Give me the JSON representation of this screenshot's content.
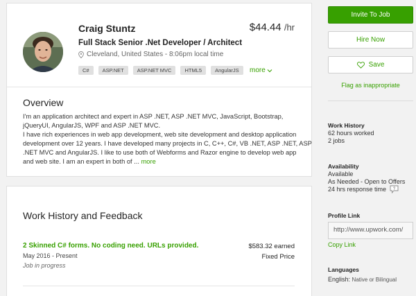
{
  "profile": {
    "name": "Craig Stuntz",
    "rate": "$44.44",
    "rate_unit": "/hr",
    "title": "Full Stack Senior .Net Developer / Architect",
    "location": "Cleveland, United States - 8:06pm local time",
    "skills": [
      "C#",
      "ASP.NET",
      "ASP.NET MVC",
      "HTML5",
      "AngularJS"
    ],
    "more_label": "more"
  },
  "overview": {
    "heading": "Overview",
    "lines": [
      "I'm an application architect and expert in ASP .NET, ASP .NET MVC, JavaScript, Bootstrap,",
      "jQueryUI, AngularJS, WPF and ASP .NET MVC.",
      "I have rich experiences in web app development, web site development and desktop application",
      "development over 12 years. I have developed many projects in C, C++, C#, VB .NET, ASP .NET, ASP",
      ".NET MVC and AngularJS. I like to use both of Webforms and Razor engine to develop web app",
      "and web site. I am an expert in both of ..."
    ],
    "more_label": "more"
  },
  "work_history": {
    "heading": "Work History and Feedback",
    "jobs": [
      {
        "title": "2 Skinned C# forms. No coding need. URLs provided.",
        "dates": "May 2016 - Present",
        "status": "Job in progress",
        "earned": "$583.32 earned",
        "type": "Fixed Price"
      }
    ]
  },
  "sidebar": {
    "invite_label": "Invite To Job",
    "hire_label": "Hire Now",
    "save_label": "Save",
    "flag_label": "Flag as inappropriate",
    "work_history_label": "Work History",
    "hours_worked": "62 hours worked",
    "jobs_count": "2 jobs",
    "availability_label": "Availability",
    "availability_status": "Available",
    "availability_detail": "As Needed - Open to Offers",
    "response_time": "24 hrs response time",
    "profile_link_label": "Profile Link",
    "profile_link_value": "http://www.upwork.com/",
    "copy_link_label": "Copy Link",
    "languages_label": "Languages",
    "language_name": "English:",
    "language_level": "Native or Bilingual"
  },
  "colors": {
    "accent": "#37a000",
    "background": "#f2f2f2"
  }
}
